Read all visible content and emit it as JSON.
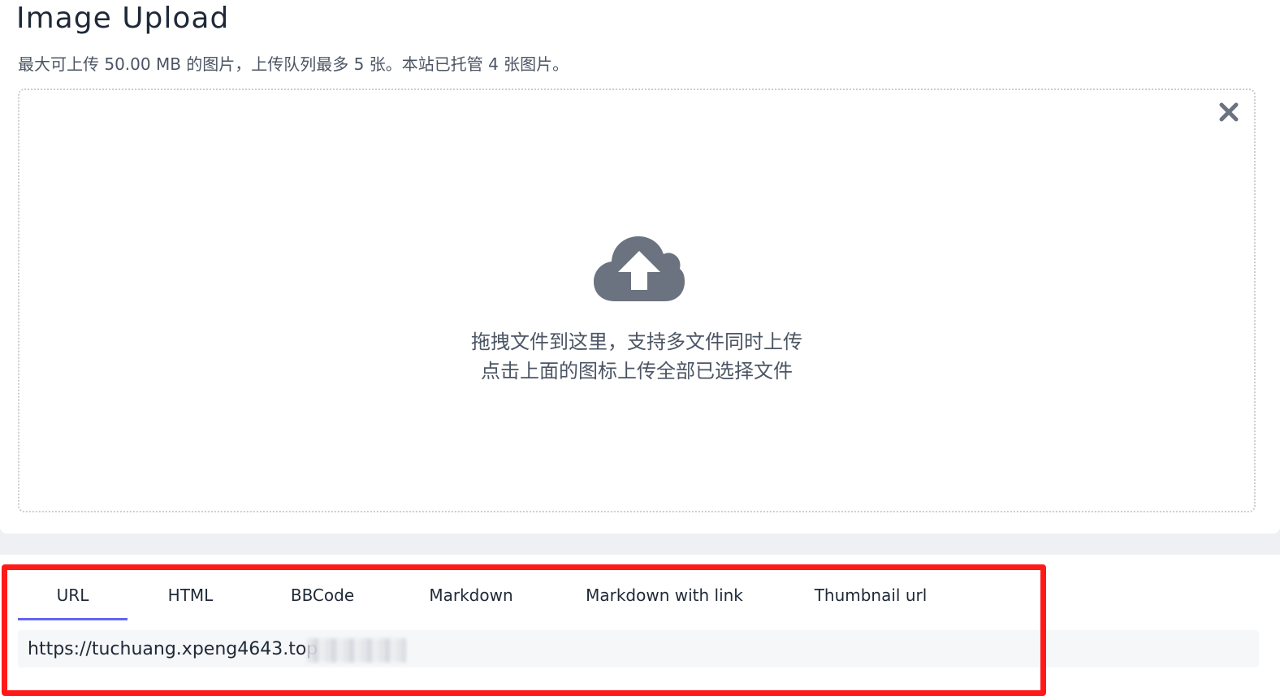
{
  "header": {
    "title": "Image Upload",
    "subtitle": "最大可上传 50.00 MB 的图片，上传队列最多 5 张。本站已托管 4 张图片。"
  },
  "dropzone": {
    "line1": "拖拽文件到这里，支持多文件同时上传",
    "line2": "点击上面的图标上传全部已选择文件",
    "upload_icon": "cloud-upload-icon",
    "close_icon": "close-icon"
  },
  "result": {
    "tabs": [
      {
        "label": "URL",
        "active": true
      },
      {
        "label": "HTML",
        "active": false
      },
      {
        "label": "BBCode",
        "active": false
      },
      {
        "label": "Markdown",
        "active": false
      },
      {
        "label": "Markdown with link",
        "active": false
      },
      {
        "label": "Thumbnail url",
        "active": false
      }
    ],
    "url_value": "https://tuchuang.xpeng4643.top"
  },
  "colors": {
    "accent": "#6366f1",
    "highlight": "#ff1a1a",
    "icon": "#6b7280"
  }
}
